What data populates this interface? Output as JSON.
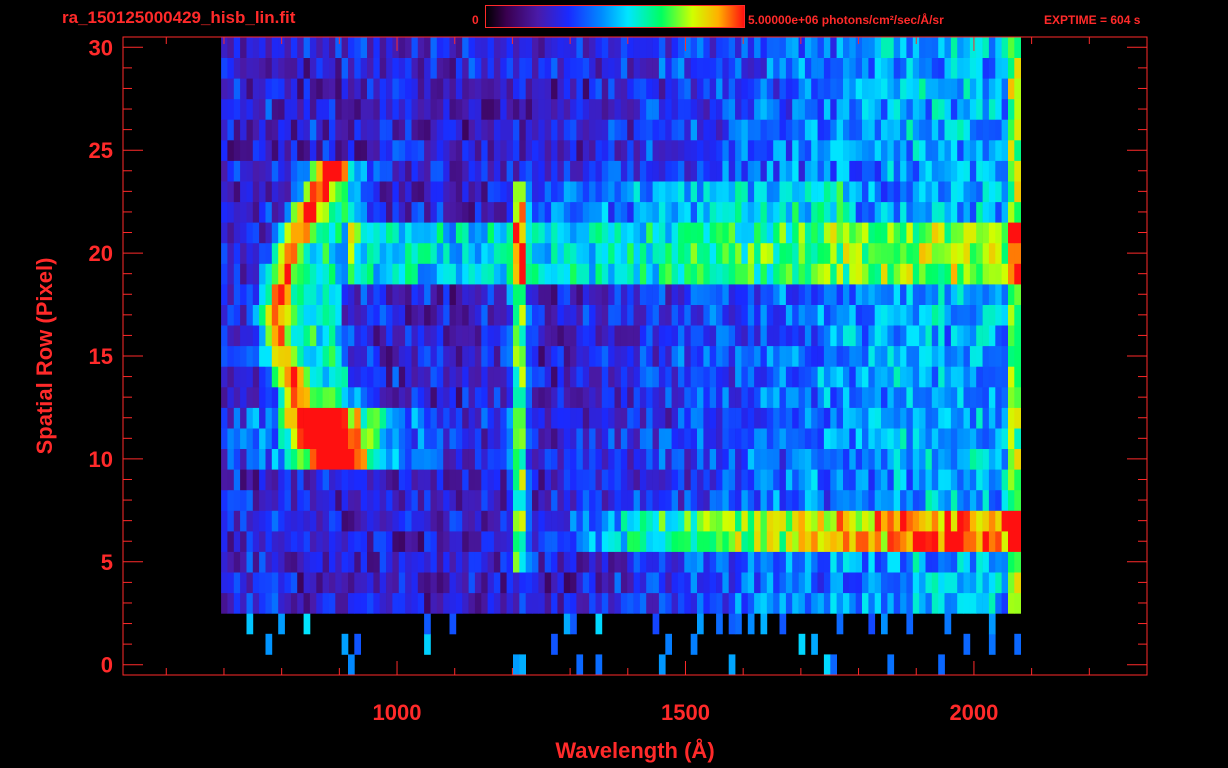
{
  "header": {
    "filename": "ra_150125000429_hisb_lin.fit",
    "colorbar_min": "0",
    "colorbar_max": "5.00000e+06 photons/cm²/sec/Å/sr",
    "exptime": "EXPTIME = 604 s"
  },
  "colors": {
    "axis": "#ff2a2a",
    "background": "#000000"
  },
  "chart_data": {
    "type": "heatmap",
    "title": "ra_150125000429_hisb_lin.fit",
    "xlabel": "Wavelength (Å)",
    "ylabel": "Spatial Row (Pixel)",
    "xlim": [
      525,
      2300
    ],
    "ylim": [
      -0.5,
      30.5
    ],
    "xticks": [
      1000,
      1500,
      2000
    ],
    "yticks": [
      0,
      5,
      10,
      15,
      20,
      25,
      30
    ],
    "colormap": "rainbow",
    "value_range": [
      0,
      5000000
    ],
    "value_unit": "photons/cm²/sec/Å/sr",
    "data_wavelength_range": [
      695,
      2075
    ],
    "data_rows": [
      0,
      30
    ],
    "features": [
      {
        "label": "arc emission (left)",
        "wavelength": [
          760,
          930
        ],
        "rows": [
          10,
          24
        ]
      },
      {
        "label": "line ~1216 Å",
        "wavelength": 1216,
        "rows": [
          5,
          24
        ]
      },
      {
        "label": "bright band",
        "wavelength": [
          1200,
          2075
        ],
        "rows": [
          6,
          8
        ]
      },
      {
        "label": "band",
        "wavelength": [
          900,
          2060
        ],
        "rows": [
          19,
          21
        ]
      }
    ]
  }
}
